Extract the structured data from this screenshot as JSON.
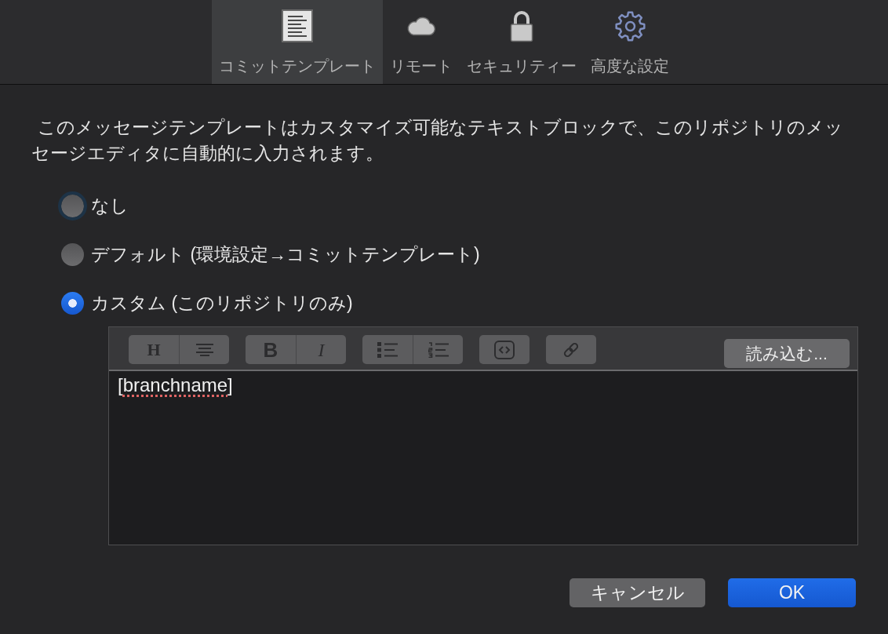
{
  "tabs": [
    {
      "label": "コミットテンプレート",
      "selected": true
    },
    {
      "label": "リモート",
      "selected": false
    },
    {
      "label": "セキュリティー",
      "selected": false
    },
    {
      "label": "高度な設定",
      "selected": false
    }
  ],
  "description": "このメッセージテンプレートはカスタマイズ可能なテキストブロックで、このリポジトリのメッセージエディタに自動的に入力されます。",
  "radio_options": [
    {
      "label": "なし",
      "selected": false,
      "focused": true
    },
    {
      "label": "デフォルト (環境設定→コミットテンプレート)",
      "selected": false,
      "focused": false
    },
    {
      "label": "カスタム (このリポジトリのみ)",
      "selected": true,
      "focused": false
    }
  ],
  "editor": {
    "toolbar": {
      "groups": [
        {
          "buttons": [
            {
              "kind": "glyph",
              "glyph": "H",
              "disabled": true
            },
            {
              "kind": "icon",
              "disabled": true
            }
          ]
        },
        {
          "buttons": [
            {
              "kind": "glyph",
              "glyph": "B",
              "disabled": true
            },
            {
              "kind": "glyph",
              "glyph": "I",
              "disabled": true
            }
          ]
        },
        {
          "buttons": [
            {
              "kind": "icon",
              "disabled": true
            },
            {
              "kind": "icon",
              "disabled": true
            }
          ]
        },
        {
          "buttons": [
            {
              "kind": "icon",
              "disabled": true
            }
          ]
        },
        {
          "buttons": [
            {
              "kind": "icon",
              "disabled": true
            }
          ]
        }
      ]
    },
    "load_button": "読み込む...",
    "content": [
      {
        "text": "[",
        "misspelled": false
      },
      {
        "text": "branchname",
        "misspelled": true
      },
      {
        "text": "]",
        "misspelled": false
      }
    ]
  },
  "buttons": [
    {
      "label": "キャンセル",
      "kind": "secondary"
    },
    {
      "label": "OK",
      "kind": "primary"
    }
  ]
}
